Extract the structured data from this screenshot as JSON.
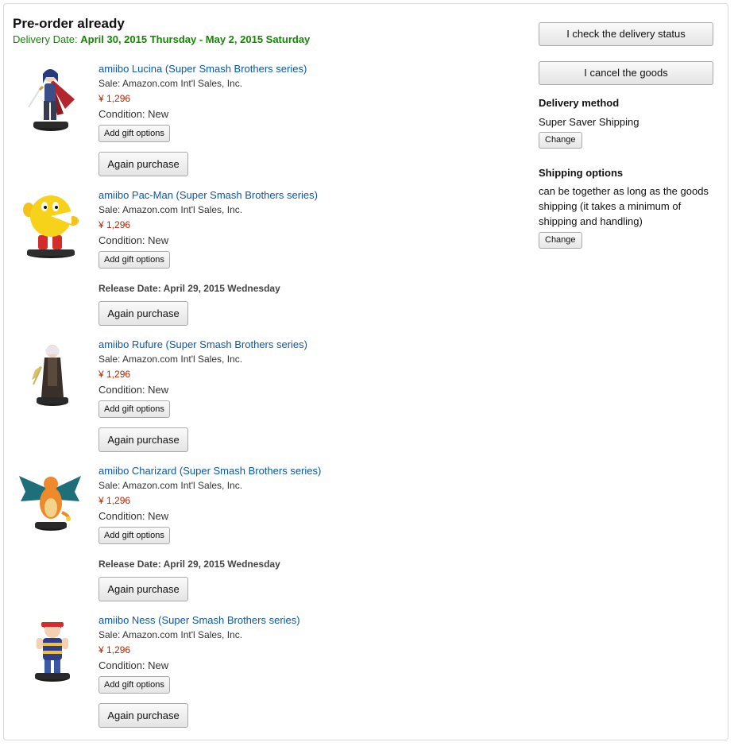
{
  "order": {
    "title": "Pre-order already",
    "delivery_label": "Delivery Date:",
    "delivery_range": "April 30, 2015 Thursday - May 2, 2015 Saturday"
  },
  "items": [
    {
      "name": "amiibo Lucina (Super Smash Brothers series)",
      "seller": "Sale: Amazon.com Int'l Sales, Inc.",
      "price": "¥ 1,296",
      "condition": "Condition: New",
      "gift_label": "Add gift options",
      "again_label": "Again purchase",
      "icon": "lucina-figure-icon"
    },
    {
      "name": "amiibo Pac-Man (Super Smash Brothers series)",
      "seller": "Sale: Amazon.com Int'l Sales, Inc.",
      "price": "¥ 1,296",
      "condition": "Condition: New",
      "gift_label": "Add gift options",
      "release": "Release Date: April 29, 2015 Wednesday",
      "again_label": "Again purchase",
      "icon": "pacman-figure-icon"
    },
    {
      "name": "amiibo Rufure (Super Smash Brothers series)",
      "seller": "Sale: Amazon.com Int'l Sales, Inc.",
      "price": "¥ 1,296",
      "condition": "Condition: New",
      "gift_label": "Add gift options",
      "again_label": "Again purchase",
      "icon": "robin-figure-icon"
    },
    {
      "name": "amiibo Charizard (Super Smash Brothers series)",
      "seller": "Sale: Amazon.com Int'l Sales, Inc.",
      "price": "¥ 1,296",
      "condition": "Condition: New",
      "gift_label": "Add gift options",
      "release": "Release Date: April 29, 2015 Wednesday",
      "again_label": "Again purchase",
      "icon": "charizard-figure-icon"
    },
    {
      "name": "amiibo Ness (Super Smash Brothers series)",
      "seller": "Sale: Amazon.com Int'l Sales, Inc.",
      "price": "¥ 1,296",
      "condition": "Condition: New",
      "gift_label": "Add gift options",
      "again_label": "Again purchase",
      "icon": "ness-figure-icon"
    }
  ],
  "sidebar": {
    "check_status_label": "I check the delivery status",
    "cancel_label": "I cancel the goods",
    "delivery_method_heading": "Delivery method",
    "delivery_method_value": "Super Saver Shipping",
    "change_label": "Change",
    "shipping_options_heading": "Shipping options",
    "shipping_options_text": "can be together as long as the goods shipping (it takes a minimum of shipping and handling)",
    "change_label_2": "Change"
  },
  "colors": {
    "link": "#0b57a8",
    "price": "#b12704",
    "delivery_green": "#118a00"
  }
}
